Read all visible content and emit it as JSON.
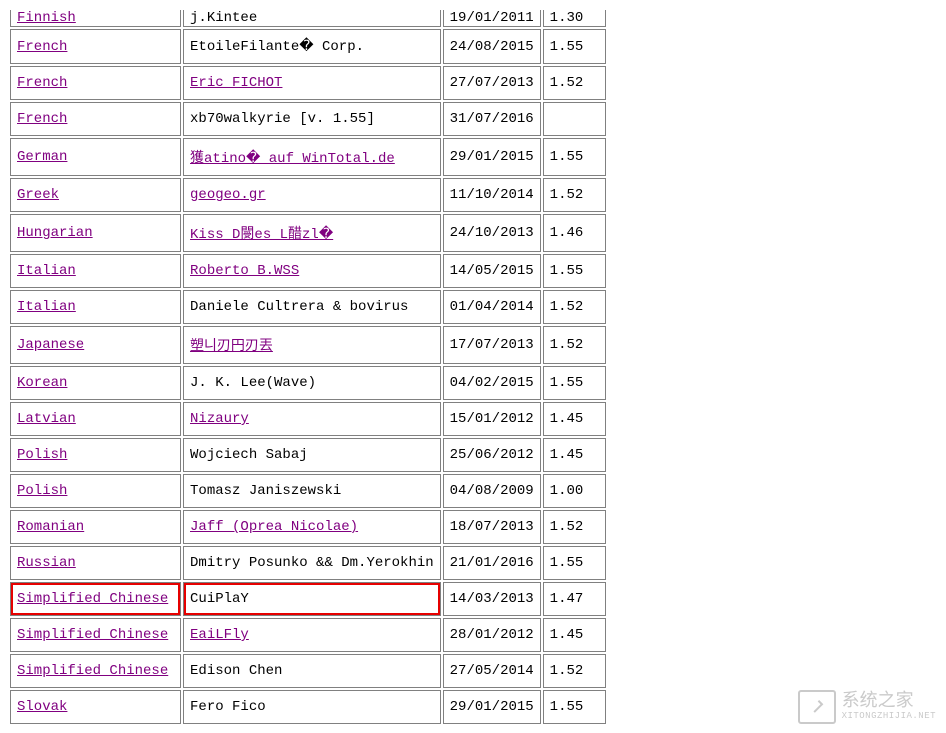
{
  "table": {
    "rows": [
      {
        "lang": "Finnish",
        "langLink": true,
        "trans": "j.Kintee",
        "transLink": false,
        "date": "19/01/2011",
        "ver": "1.30",
        "cut": true
      },
      {
        "lang": "French",
        "langLink": true,
        "trans": "EtoileFilante� Corp.",
        "transLink": false,
        "date": "24/08/2015",
        "ver": "1.55"
      },
      {
        "lang": "French",
        "langLink": true,
        "trans": "Eric FICHOT",
        "transLink": true,
        "date": "27/07/2013",
        "ver": "1.52"
      },
      {
        "lang": "French",
        "langLink": true,
        "trans": "xb70walkyrie [v. 1.55]",
        "transLink": false,
        "date": "31/07/2016",
        "ver": ""
      },
      {
        "lang": "German",
        "langLink": true,
        "trans": "獲atino� auf WinTotal.de",
        "transLink": true,
        "date": "29/01/2015",
        "ver": "1.55"
      },
      {
        "lang": "Greek",
        "langLink": true,
        "trans": "geogeo.gr",
        "transLink": true,
        "date": "11/10/2014",
        "ver": "1.52"
      },
      {
        "lang": "Hungarian",
        "langLink": true,
        "trans": "Kiss D閿es L醋zl�",
        "transLink": true,
        "date": "24/10/2013",
        "ver": "1.46"
      },
      {
        "lang": "Italian",
        "langLink": true,
        "trans": "Roberto B.WSS",
        "transLink": true,
        "date": "14/05/2015",
        "ver": "1.55"
      },
      {
        "lang": "Italian",
        "langLink": true,
        "trans": "Daniele Cultrera & bovirus",
        "transLink": false,
        "date": "01/04/2014",
        "ver": "1.52"
      },
      {
        "lang": "Japanese",
        "langLink": true,
        "trans": "塑니刃円刃丟",
        "transLink": true,
        "date": "17/07/2013",
        "ver": "1.52"
      },
      {
        "lang": "Korean",
        "langLink": true,
        "trans": "J. K. Lee(Wave)",
        "transLink": false,
        "date": "04/02/2015",
        "ver": "1.55"
      },
      {
        "lang": "Latvian",
        "langLink": true,
        "trans": "Nizaury",
        "transLink": true,
        "date": "15/01/2012",
        "ver": "1.45"
      },
      {
        "lang": "Polish",
        "langLink": true,
        "trans": "Wojciech Sabaj",
        "transLink": false,
        "date": "25/06/2012",
        "ver": "1.45"
      },
      {
        "lang": "Polish",
        "langLink": true,
        "trans": "Tomasz Janiszewski",
        "transLink": false,
        "date": "04/08/2009",
        "ver": "1.00"
      },
      {
        "lang": "Romanian",
        "langLink": true,
        "trans": "Jaff (Oprea Nicolae)",
        "transLink": true,
        "date": "18/07/2013",
        "ver": "1.52"
      },
      {
        "lang": "Russian",
        "langLink": true,
        "trans": "Dmitry Posunko && Dm.Yerokhin",
        "transLink": false,
        "date": "21/01/2016",
        "ver": "1.55"
      },
      {
        "lang": "Simplified Chinese",
        "langLink": true,
        "trans": "CuiPlaY",
        "transLink": false,
        "date": "14/03/2013",
        "ver": "1.47",
        "highlight": true
      },
      {
        "lang": "Simplified Chinese",
        "langLink": true,
        "trans": "EaiLFly",
        "transLink": true,
        "date": "28/01/2012",
        "ver": "1.45"
      },
      {
        "lang": "Simplified Chinese",
        "langLink": true,
        "trans": "Edison Chen",
        "transLink": false,
        "date": "27/05/2014",
        "ver": "1.52"
      },
      {
        "lang": "Slovak",
        "langLink": true,
        "trans": "Fero Fico",
        "transLink": false,
        "date": "29/01/2015",
        "ver": "1.55"
      }
    ]
  },
  "watermark": {
    "main": "系统之家",
    "sub": "XITONGZHIJIA.NET"
  }
}
